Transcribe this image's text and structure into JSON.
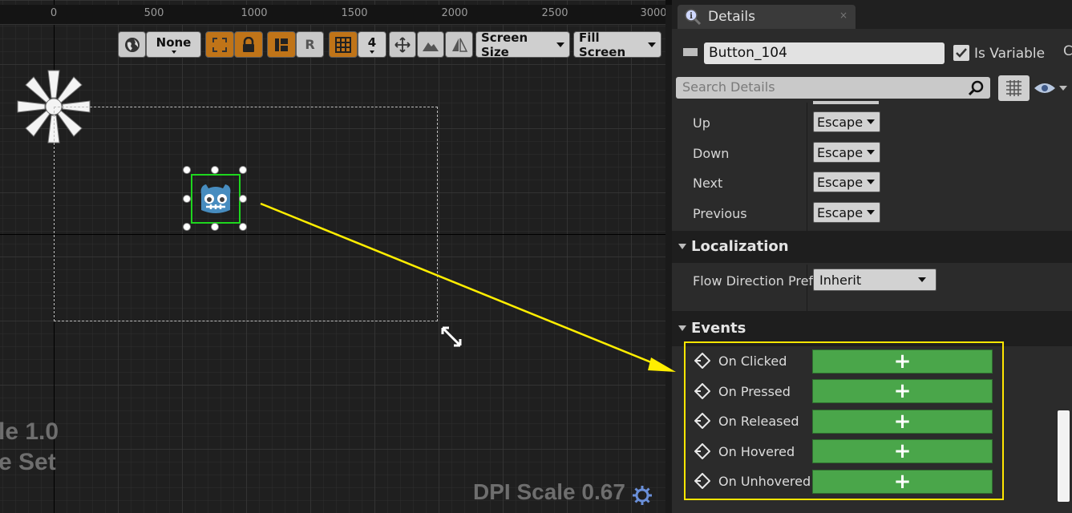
{
  "viewport": {
    "ruler_ticks": [
      "0",
      "500",
      "1000",
      "1500",
      "2000",
      "2500",
      "3000"
    ],
    "toolbar": {
      "none_label": "None",
      "r_label": "R",
      "grid_value": "4",
      "screen_size_label": "Screen Size",
      "fill_screen_label": "Fill Screen"
    },
    "overlay_text": {
      "scale_line1": "le 1.0",
      "scale_line2": "e Set",
      "dpi_scale": "DPI Scale 0.67"
    },
    "colors": {
      "selection": "#1ed61e",
      "arrow": "#ffee00",
      "toolbar_orange": "#c07418"
    }
  },
  "details": {
    "tab_title": "Details",
    "widget_name": "Button_104",
    "is_variable_label": "Is Variable",
    "is_variable_checked": true,
    "search_placeholder": "Search Details",
    "navigation": [
      {
        "label": "Up",
        "value": "Escape"
      },
      {
        "label": "Down",
        "value": "Escape"
      },
      {
        "label": "Next",
        "value": "Escape"
      },
      {
        "label": "Previous",
        "value": "Escape"
      }
    ],
    "localization": {
      "section_label": "Localization",
      "flow_label": "Flow Direction Prefe",
      "flow_value": "Inherit"
    },
    "events": {
      "section_label": "Events",
      "items": [
        "On Clicked",
        "On Pressed",
        "On Released",
        "On Hovered",
        "On Unhovered"
      ],
      "add_symbol": "+"
    },
    "colors": {
      "event_button": "#4aa64a",
      "highlight": "#ffe600"
    }
  }
}
